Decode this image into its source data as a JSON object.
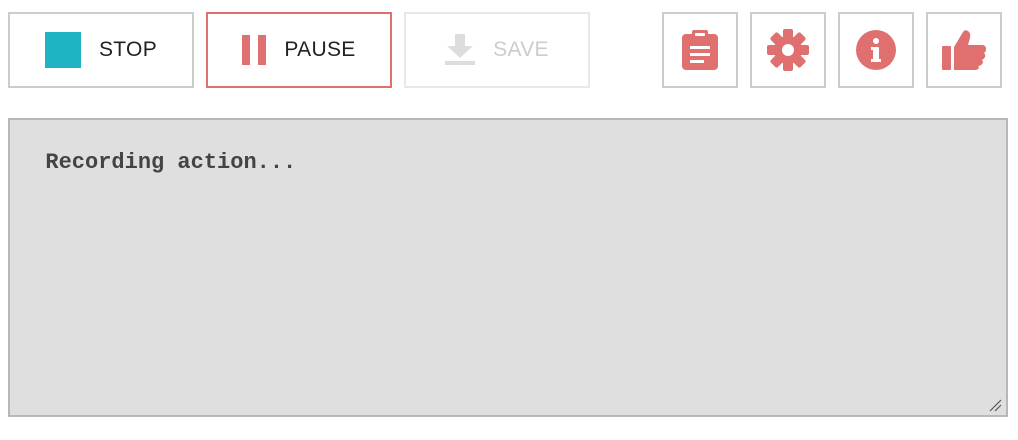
{
  "toolbar": {
    "stop_label": "STOP",
    "pause_label": "PAUSE",
    "save_label": "SAVE",
    "icons": {
      "stop": "stop-square-icon",
      "pause": "pause-icon",
      "save": "download-icon",
      "log": "clipboard-icon",
      "settings": "gear-icon",
      "info": "info-icon",
      "like": "thumbs-up-icon"
    }
  },
  "log": {
    "text": "Recording action..."
  },
  "colors": {
    "accent": "#e07070",
    "stop": "#1fb3c4",
    "disabled": "#cccccc",
    "log_bg": "#dfdfdf"
  }
}
